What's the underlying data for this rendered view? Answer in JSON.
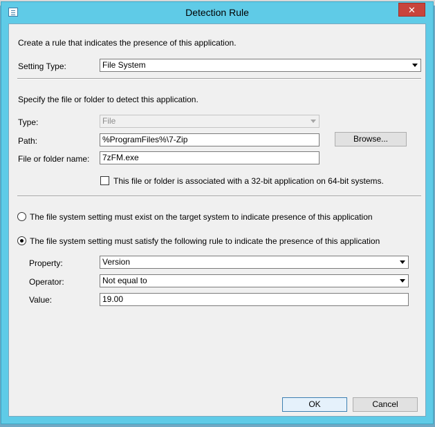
{
  "window": {
    "title": "Detection Rule",
    "close_glyph": "✕",
    "app_icon": "dialog-icon"
  },
  "intro": "Create a rule that indicates the presence of this application.",
  "setting_type": {
    "label": "Setting Type:",
    "value": "File System"
  },
  "file_section": {
    "heading": "Specify the file or folder to detect this application.",
    "type_label": "Type:",
    "type_value": "File",
    "path_label": "Path:",
    "path_value": "%ProgramFiles%\\7-Zip",
    "browse_label": "Browse...",
    "name_label": "File or folder name:",
    "name_value": "7zFM.exe",
    "bit32_label": "This file or folder is associated with a 32-bit application on 64-bit systems.",
    "bit32_checked": false
  },
  "rule_options": {
    "exist_label": "The file system setting must exist on the target system to indicate presence of this application",
    "exist_selected": false,
    "satisfy_label": "The file system setting must satisfy the following rule to indicate the presence of this application",
    "satisfy_selected": true
  },
  "rule": {
    "property_label": "Property:",
    "property_value": "Version",
    "operator_label": "Operator:",
    "operator_value": "Not equal to",
    "value_label": "Value:",
    "value_value": "19.00"
  },
  "buttons": {
    "ok": "OK",
    "cancel": "Cancel"
  },
  "colors": {
    "frame": "#5fcbe7",
    "close": "#c8443c",
    "client": "#f0f0f0"
  }
}
